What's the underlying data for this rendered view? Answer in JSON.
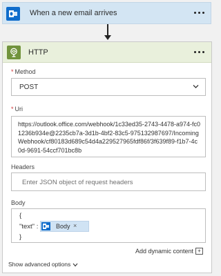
{
  "trigger": {
    "title": "When a new email arrives",
    "icon": "outlook-icon",
    "accent": "#0f6ccb"
  },
  "connector": {
    "icon": "arrow-down-icon"
  },
  "http_action": {
    "title": "HTTP",
    "icon": "globe-icon",
    "accent": "#71933c",
    "fields": {
      "method": {
        "label": "Method",
        "required_marker": "*",
        "value": "POST"
      },
      "uri": {
        "label": "Uri",
        "required_marker": "*",
        "value": "https://outlook.office.com/webhook/1c33ed35-2743-4478-a974-fc01236b934e@2235cb7a-3d1b-4bf2-83c5-975132987697/IncomingWebhook/cf80183d689c54d4a229527965fdf86f/3f639f89-f1b7-4c0d-9691-54ccf701bc8b"
      },
      "headers": {
        "label": "Headers",
        "placeholder": "Enter JSON object of request headers"
      },
      "body": {
        "label": "Body",
        "open_brace": "{",
        "key_text": "\"text\" :",
        "token_label": "Body",
        "token_remove": "×",
        "close_brace": "}"
      }
    },
    "add_dynamic_content": "Add dynamic content",
    "show_advanced": "Show advanced options"
  }
}
